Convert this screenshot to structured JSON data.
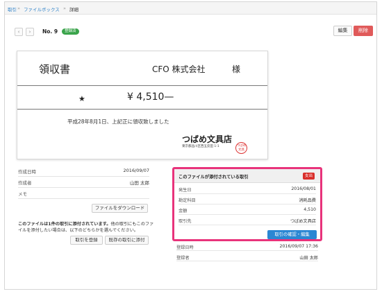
{
  "breadcrumb": [
    {
      "label": "取引",
      "link": true
    },
    {
      "label": "ファイルボックス",
      "link": true
    },
    {
      "label": "詳細",
      "link": false
    }
  ],
  "breadcrumb_separator": "»",
  "nav": {
    "prev_icon": "chevron-left-icon",
    "next_icon": "chevron-right-icon",
    "prev_glyph": "‹",
    "next_glyph": "›"
  },
  "header": {
    "doc_no": "No. 9",
    "status_badge": "登録済",
    "status_color": "#3aa44b"
  },
  "actions": {
    "edit_label": "編集",
    "delete_label": "削除",
    "delete_color": "#e05a5a"
  },
  "receipt": {
    "title": "領収書",
    "customer": "CFO 株式会社",
    "honorific": "様",
    "star": "★",
    "amount": "¥ 4,510—",
    "note": "平成28年8月1日、上記正に領収致しました",
    "issuer": "つばめ文具店",
    "address": "東京都品川区西五反田 1-1",
    "stamp": "つばめ文具"
  },
  "file_info": {
    "rows": [
      {
        "key": "作成日時",
        "value": "2016/09/07"
      },
      {
        "key": "作成者",
        "value": "山田 太郎"
      },
      {
        "key": "メモ",
        "value": ""
      }
    ],
    "download_label": "ファイルをダウンロード",
    "notice_bold": "このファイルは1件の取引に添付されています。",
    "notice_rest": "他の取引にもこのファイルを添付したい場合は、以下のどちらかを選んでください。",
    "register_label": "取引を登録",
    "attach_label": "既存の取引に添付"
  },
  "related_deal": {
    "title": "このファイルが添付されている取引",
    "type_badge": "支出",
    "badge_color": "#d9302c",
    "rows": [
      {
        "key": "発生日",
        "value": "2016/08/01"
      },
      {
        "key": "勘定科目",
        "value": "消耗品費"
      },
      {
        "key": "金額",
        "value": "4,510"
      },
      {
        "key": "取引先",
        "value": "つばめ文具店"
      }
    ],
    "confirm_label": "取引の確認・編集",
    "highlight_color": "#e8337b"
  },
  "deal_meta": {
    "rows": [
      {
        "key": "登録日時",
        "value": "2016/09/07 17:36"
      },
      {
        "key": "登録者",
        "value": "山田 太郎"
      }
    ]
  }
}
